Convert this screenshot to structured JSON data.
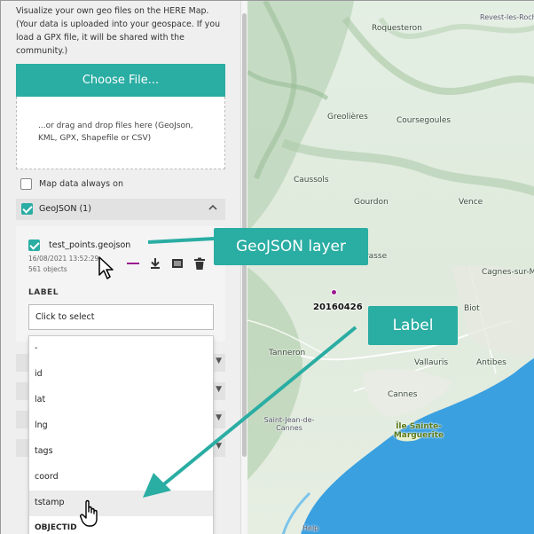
{
  "panel": {
    "intro_text": "Visualize your own geo files on the HERE Map. (Your data is uploaded into your geospace. If you load a GPX file, it will be shared with the community.)",
    "choose_file_label": "Choose File...",
    "drop_zone_text": "...or drag and drop files here (GeoJson, KML, GPX, Shapefile or CSV)",
    "map_data_always_on_label": "Map data always on",
    "map_data_always_on_checked": false,
    "group_label": "GeoJSON (1)",
    "group_checked": true,
    "layer": {
      "name": "test_points.geojson",
      "checked": true,
      "date": "16/08/2021 13:52:29",
      "count": "561 objects",
      "line_color": "#9c1a90",
      "tools": [
        "download-icon",
        "table-icon",
        "trash-icon"
      ]
    },
    "label_heading": "LABEL",
    "label_select_value": "Click to select",
    "dropdown_options": [
      "-",
      "id",
      "lat",
      "lng",
      "tags",
      "coord",
      "tstamp",
      "OBJECTID"
    ]
  },
  "map": {
    "places": [
      "Revest-les-Roches",
      "Roquesteron",
      "Greolières",
      "Coursegoules",
      "Caussols",
      "Gourdon",
      "Vence",
      "Cagnes-sur-Mer",
      "Grasse",
      "Biot",
      "Tanneron",
      "Vallauris",
      "Antibes",
      "Cannes",
      "Saint-Jean-de-Cannes",
      "Île Sainte-Marguerite",
      "Help"
    ],
    "point_label": "20160426",
    "point_color": "#9c1a90",
    "sea_color": "#3aa0e0"
  },
  "callouts": {
    "geojson_layer": "GeoJSON layer",
    "label": "Label",
    "color": "#2aada3"
  }
}
